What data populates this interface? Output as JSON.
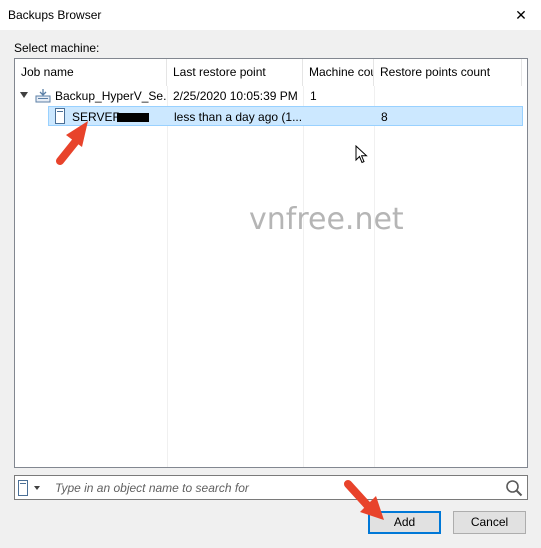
{
  "window": {
    "title": "Backups Browser",
    "close_glyph": "✕"
  },
  "label": {
    "select_machine": "Select machine:"
  },
  "grid": {
    "columns": [
      "Job name",
      "Last restore point",
      "Machine cou",
      "Restore points count"
    ],
    "rows": [
      {
        "job_name": "Backup_HyperV_Se...",
        "last_restore_point": "2/25/2020 10:05:39 PM",
        "machine_count": "1",
        "restore_points_count": "",
        "icon": "backup-job-icon",
        "expanded": true
      },
      {
        "job_name": "SERVER-",
        "last_restore_point": "less than a day ago (1...",
        "machine_count": "",
        "restore_points_count": "8",
        "icon": "server-icon",
        "selected": true
      }
    ]
  },
  "search": {
    "placeholder": "Type in an object name to search for",
    "value": "",
    "type_icon": "server-icon",
    "search_icon": "magnifier-icon"
  },
  "buttons": {
    "add": "Add",
    "cancel": "Cancel"
  },
  "watermark": "vnfree.net",
  "colors": {
    "selection_bg": "#cce8ff",
    "selection_border": "#99d1ff",
    "primary_button_border": "#0078d7",
    "annotation_arrow": "#e8432b"
  }
}
